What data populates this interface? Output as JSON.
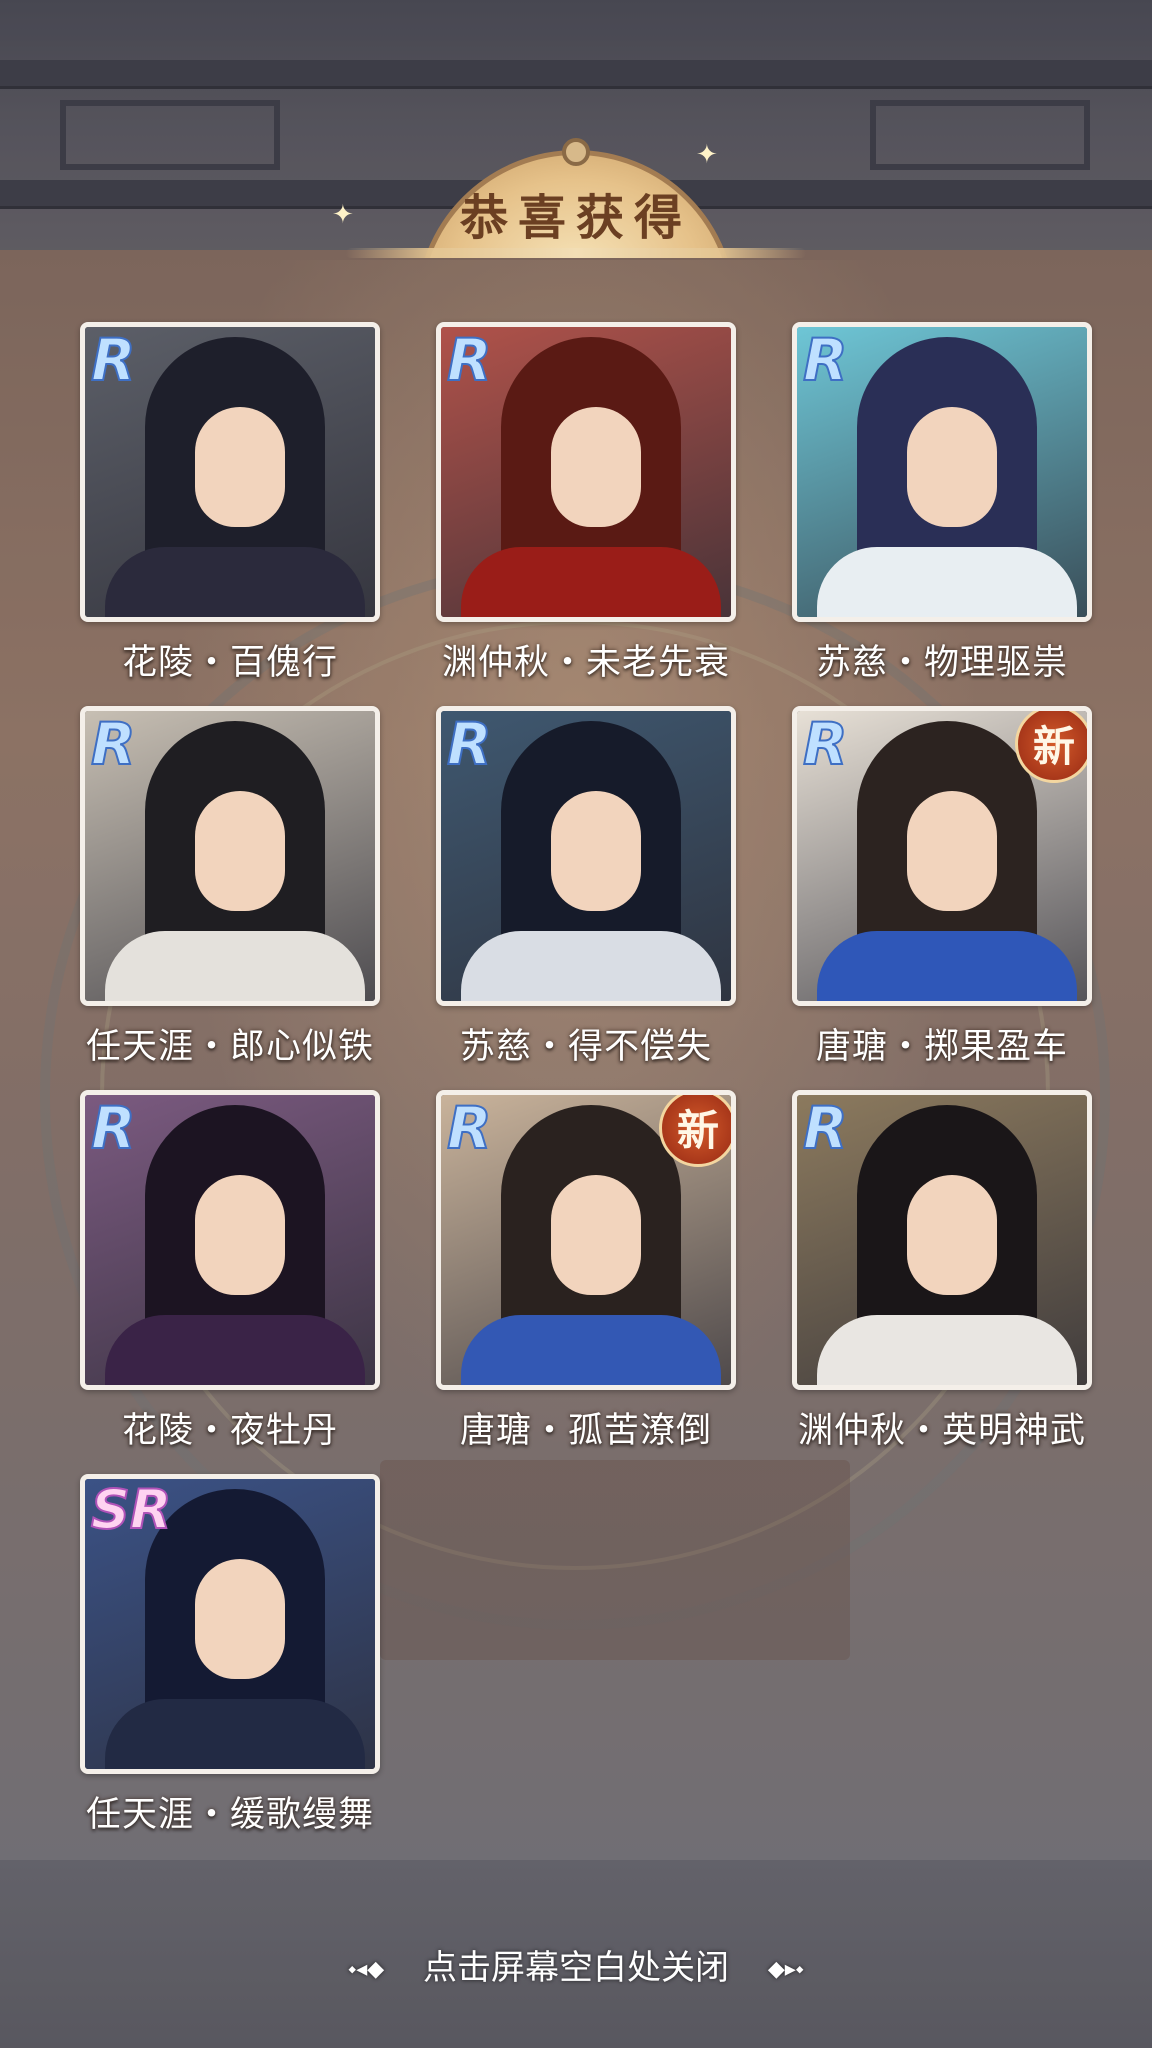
{
  "header": {
    "title": "恭喜获得"
  },
  "cards": [
    {
      "name": "花陵・百傀行",
      "rarity": "R",
      "is_new": false,
      "hair": "#1e1f2b",
      "robe": "#2b2a3c",
      "bg": "#5c5f68"
    },
    {
      "name": "渊仲秋・未老先衰",
      "rarity": "R",
      "is_new": false,
      "hair": "#5a1a14",
      "robe": "#9a1d18",
      "bg": "#b0524a"
    },
    {
      "name": "苏慈・物理驱祟",
      "rarity": "R",
      "is_new": false,
      "hair": "#2a2f56",
      "robe": "#e8eef2",
      "bg": "#6ec6d6"
    },
    {
      "name": "任天涯・郎心似铁",
      "rarity": "R",
      "is_new": false,
      "hair": "#1f1e22",
      "robe": "#e4e1dc",
      "bg": "#c7bfb3"
    },
    {
      "name": "苏慈・得不偿失",
      "rarity": "R",
      "is_new": false,
      "hair": "#161b2a",
      "robe": "#d9dde4",
      "bg": "#3f5870"
    },
    {
      "name": "唐瑭・掷果盈车",
      "rarity": "R",
      "is_new": true,
      "hair": "#2c2320",
      "robe": "#2f57b8",
      "bg": "#e7e0d6"
    },
    {
      "name": "花陵・夜牡丹",
      "rarity": "R",
      "is_new": false,
      "hair": "#1c1422",
      "robe": "#3a2347",
      "bg": "#7b5a80"
    },
    {
      "name": "唐瑭・孤苦潦倒",
      "rarity": "R",
      "is_new": true,
      "hair": "#2a221f",
      "robe": "#3358b4",
      "bg": "#c9b39b"
    },
    {
      "name": "渊仲秋・英明神武",
      "rarity": "R",
      "is_new": false,
      "hair": "#1a1618",
      "robe": "#e9e6e2",
      "bg": "#8c7a5e"
    },
    {
      "name": "任天涯・缓歌缦舞",
      "rarity": "SR",
      "is_new": false,
      "hair": "#141a33",
      "robe": "#222a44",
      "bg": "#3b5286"
    }
  ],
  "new_badge_label": "新",
  "footer": {
    "hint": "点击屏幕空白处关闭",
    "left_deco": "⬩◂◆",
    "right_deco": "◆▸⬩"
  }
}
